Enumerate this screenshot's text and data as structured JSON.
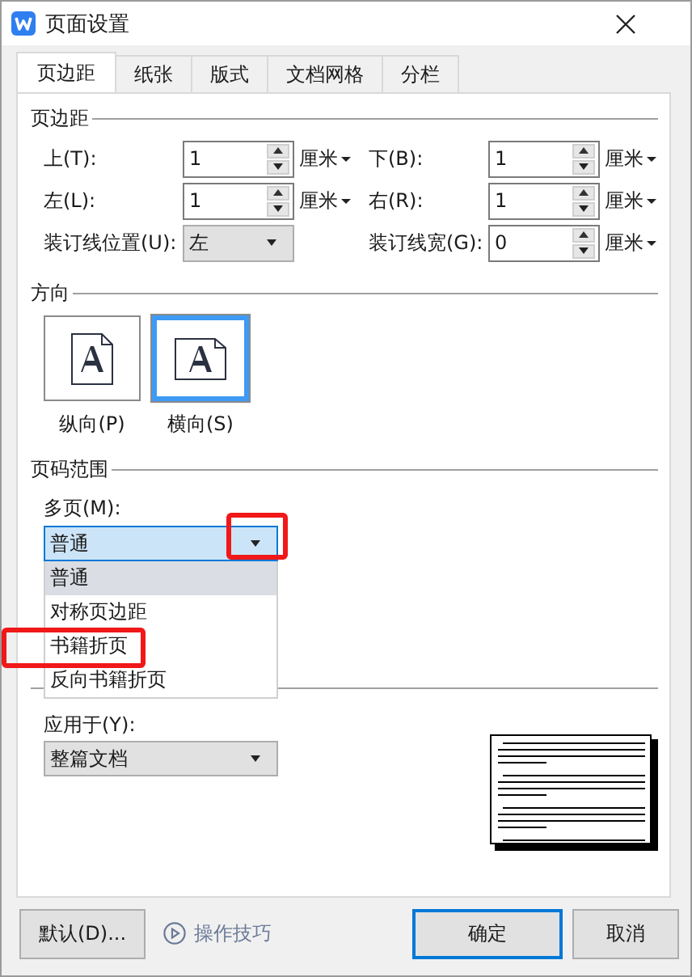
{
  "window": {
    "title": "页面设置"
  },
  "tabs": [
    {
      "label": "页边距",
      "selected": true
    },
    {
      "label": "纸张",
      "selected": false
    },
    {
      "label": "版式",
      "selected": false
    },
    {
      "label": "文档网格",
      "selected": false
    },
    {
      "label": "分栏",
      "selected": false
    }
  ],
  "margins": {
    "title": "页边距",
    "fields": [
      {
        "kind": "spin",
        "label": "上(T):",
        "value": "1",
        "unit": "厘米"
      },
      {
        "kind": "spin",
        "label": "下(B):",
        "value": "1",
        "unit": "厘米"
      },
      {
        "kind": "spin",
        "label": "左(L):",
        "value": "1",
        "unit": "厘米"
      },
      {
        "kind": "spin",
        "label": "右(R):",
        "value": "1",
        "unit": "厘米"
      },
      {
        "kind": "dropdown",
        "label": "装订线位置(U):",
        "value": "左"
      },
      {
        "kind": "spin",
        "label": "装订线宽(G):",
        "value": "0",
        "unit": "厘米"
      }
    ]
  },
  "orientation": {
    "title": "方向",
    "options": [
      {
        "kind": "portrait",
        "label": "纵向(P)",
        "selected": false
      },
      {
        "kind": "landscape",
        "label": "横向(S)",
        "selected": true
      }
    ]
  },
  "page_range": {
    "title": "页码范围",
    "label": "多页(M):",
    "value": "普通",
    "expanded": true,
    "options": [
      {
        "label": "普通",
        "selected": true
      },
      {
        "label": "对称页边距",
        "selected": false
      },
      {
        "label": "书籍折页",
        "selected": false
      },
      {
        "label": "反向书籍折页",
        "selected": false
      }
    ]
  },
  "apply": {
    "label": "应用于(Y):",
    "value": "整篇文档"
  },
  "footer": {
    "default_button": "默认(D)...",
    "tips_link": "操作技巧",
    "ok_button": "确定",
    "cancel_button": "取消"
  }
}
